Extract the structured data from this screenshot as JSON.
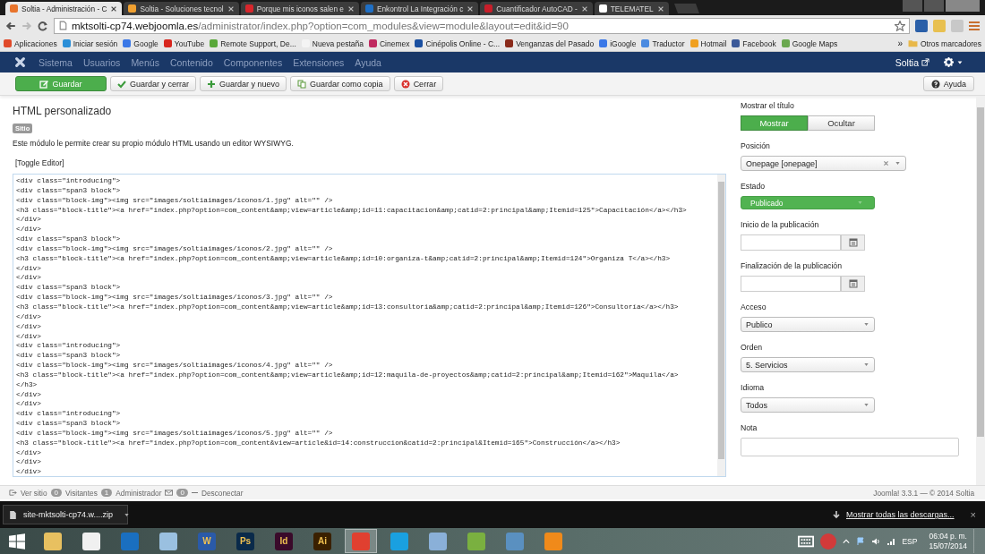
{
  "browser_tabs": [
    {
      "title": "Soltia - Administración - C",
      "color": "#e8742c",
      "selected": true
    },
    {
      "title": "Soltia - Soluciones tecnol",
      "color": "#f0a030",
      "selected": false
    },
    {
      "title": "Porque mis iconos salen e",
      "color": "#d8262c",
      "selected": false
    },
    {
      "title": "Enkontrol La Integración c",
      "color": "#1f6fc5",
      "selected": false
    },
    {
      "title": "Cuantificador AutoCAD -",
      "color": "#c81e2a",
      "selected": false
    },
    {
      "title": "TELEMATEL",
      "color": "#ffffff",
      "selected": false
    }
  ],
  "address": {
    "host": "mktsolti-cp74.webjoomla.es",
    "path": "/administrator/index.php?option=com_modules&view=module&layout=edit&id=90"
  },
  "bookmarks": [
    {
      "label": "Aplicaciones",
      "color": "#e04a2a"
    },
    {
      "label": "Iniciar sesión",
      "color": "#2b8fd8"
    },
    {
      "label": "Google",
      "color": "#3b78e7"
    },
    {
      "label": "YouTube",
      "color": "#d8261e"
    },
    {
      "label": "Remote Support, De...",
      "color": "#5aa83a"
    },
    {
      "label": "Nueva pestaña",
      "color": "#f4f4f4"
    },
    {
      "label": "Cinemex",
      "color": "#c02a60"
    },
    {
      "label": "Cinépolis Online - C...",
      "color": "#1a4fa0"
    },
    {
      "label": "Venganzas del Pasado",
      "color": "#8a2a1a"
    },
    {
      "label": "iGoogle",
      "color": "#3b78e7"
    },
    {
      "label": "Traductor",
      "color": "#4a8ae0"
    },
    {
      "label": "Hotmail",
      "color": "#f0a020"
    },
    {
      "label": "Facebook",
      "color": "#3b5998"
    },
    {
      "label": "Google Maps",
      "color": "#6aa84f"
    }
  ],
  "bookmarks_more": "»",
  "other_bookmarks": "Otros marcadores",
  "admin_menu": [
    "Sistema",
    "Usuarios",
    "Menús",
    "Contenido",
    "Componentes",
    "Extensiones",
    "Ayuda"
  ],
  "admin_user": "Soltia",
  "toolbar": {
    "buttons": [
      {
        "label": "Guardar",
        "kind": "primary"
      },
      {
        "label": "Guardar y cerrar",
        "kind": "default"
      },
      {
        "label": "Guardar y nuevo",
        "kind": "default"
      },
      {
        "label": "Guardar como copia",
        "kind": "default"
      },
      {
        "label": "Cerrar",
        "kind": "default"
      }
    ],
    "help": "Ayuda"
  },
  "module": {
    "title": "HTML personalizado",
    "badge": "Sitio",
    "description": "Este módulo le permite crear su propio módulo HTML usando un editor WYSIWYG."
  },
  "editor": {
    "toggle": "[Toggle Editor]",
    "lines": [
      "<div class=\"introducing\">",
      "<div class=\"span3 block\">",
      "<div class=\"block-img\"><img src=\"images/soltiaimages/iconos/1.jpg\" alt=\"\" />",
      "<h3 class=\"block-title\"><a href=\"index.php?option=com_content&amp;view=article&amp;id=11:capacitacion&amp;catid=2:principal&amp;Itemid=125\">Capacitación</a></h3>",
      "</div>",
      "</div>",
      "<div class=\"span3 block\">",
      "<div class=\"block-img\"><img src=\"images/soltiaimages/iconos/2.jpg\" alt=\"\" />",
      "<h3 class=\"block-title\"><a href=\"index.php?option=com_content&amp;view=article&amp;id=10:organiza-t&amp;catid=2:principal&amp;Itemid=124\">Organiza T</a></h3>",
      "</div>",
      "</div>",
      "<div class=\"span3 block\">",
      "<div class=\"block-img\"><img src=\"images/soltiaimages/iconos/3.jpg\" alt=\"\" />",
      "<h3 class=\"block-title\"><a href=\"index.php?option=com_content&amp;view=article&amp;id=13:consultoria&amp;catid=2:principal&amp;Itemid=126\">Consultoría</a></h3>",
      "</div>",
      "</div>",
      "</div>",
      "<div class=\"introducing\">",
      "<div class=\"span3 block\">",
      "<div class=\"block-img\"><img src=\"images/soltiaimages/iconos/4.jpg\" alt=\"\" />",
      "<h3 class=\"block-title\"><a href=\"index.php?option=com_content&amp;view=article&amp;id=12:maquila-de-proyectos&amp;catid=2:principal&amp;Itemid=162\">Maquila</a>",
      "</h3>",
      "</div>",
      "</div>",
      "<div class=\"introducing\">",
      "<div class=\"span3 block\">",
      "<div class=\"block-img\"><img src=\"images/soltiaimages/iconos/5.jpg\" alt=\"\" />",
      "<h3 class=\"block-title\"><a href=\"index.php?option=com_content&view=article&id=14:construccion&catid=2:principal&Itemid=165\">Construcción</a></h3>",
      "</div>",
      "</div>",
      "</div>"
    ]
  },
  "settings": [
    {
      "kind": "toggle",
      "label": "Mostrar el título",
      "options": [
        {
          "label": "Mostrar",
          "selected": true
        },
        {
          "label": "Ocultar",
          "selected": false
        }
      ]
    },
    {
      "kind": "select",
      "label": "Posición",
      "value": "Onepage [onepage]",
      "clearable": true
    },
    {
      "kind": "status",
      "label": "Estado",
      "value": "Publicado"
    },
    {
      "kind": "date",
      "label": "Inicio de la publicación"
    },
    {
      "kind": "date",
      "label": "Finalización de la publicación"
    },
    {
      "kind": "select",
      "label": "Acceso",
      "value": "Publico"
    },
    {
      "kind": "select",
      "label": "Orden",
      "value": "5. Servicios"
    },
    {
      "kind": "select",
      "label": "Idioma",
      "value": "Todos"
    },
    {
      "kind": "text",
      "label": "Nota"
    }
  ],
  "status_bar": {
    "view_site": "Ver sitio",
    "visitors": "0",
    "visitors_label": "Visitantes",
    "admins": "1",
    "admins_label": "Administrador",
    "messages": "0",
    "logout": "Desconectar",
    "version": "Joomla! 3.3.1 — © 2014 Soltia"
  },
  "downloads": {
    "file": "site-mktsolti-cp74.w....zip",
    "show_all": "Mostrar todas las descargas...",
    "close": "×"
  },
  "taskbar": {
    "apps": [
      {
        "color": "#e8c060",
        "selected": false
      },
      {
        "color": "#f0f0f0",
        "selected": false
      },
      {
        "color": "#1a6fc0",
        "selected": false
      },
      {
        "color": "#9ac0e0",
        "selected": false
      },
      {
        "label": "W",
        "color": "#2a5aa8",
        "selected": false
      },
      {
        "label": "Ps",
        "color": "#0a2a4a",
        "selected": false
      },
      {
        "label": "Id",
        "color": "#3a0a2a",
        "selected": false
      },
      {
        "label": "Ai",
        "color": "#3a2000",
        "selected": false
      },
      {
        "color": "#e04030",
        "selected": true
      },
      {
        "color": "#1aa0e0",
        "selected": false
      },
      {
        "color": "#8ab0d8",
        "selected": false
      },
      {
        "color": "#7ab040",
        "selected": false
      },
      {
        "color": "#5a90c0",
        "selected": false
      },
      {
        "color": "#f08a1a",
        "selected": false
      }
    ],
    "language": "ESP",
    "time": "06:04 p. m.",
    "date": "15/07/2014"
  }
}
